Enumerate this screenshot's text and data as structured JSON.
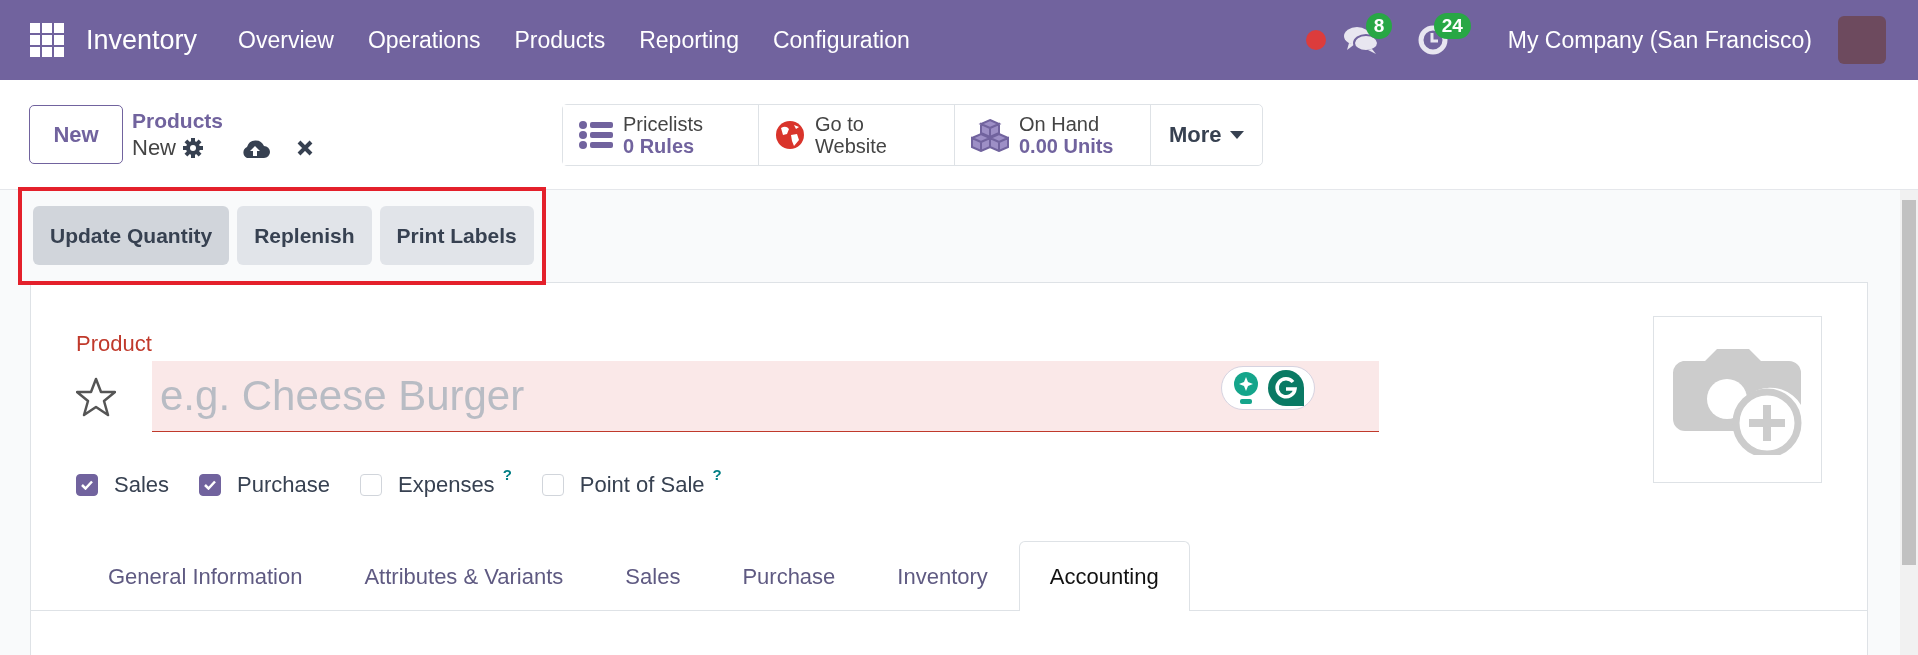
{
  "navbar": {
    "app_name": "Inventory",
    "menu": [
      "Overview",
      "Operations",
      "Products",
      "Reporting",
      "Configuration"
    ],
    "messages_badge": "8",
    "activities_badge": "24",
    "company": "My Company (San Francisco)"
  },
  "control_panel": {
    "new_button": "New",
    "breadcrumb": {
      "parent": "Products",
      "current": "New"
    },
    "stat_buttons": [
      {
        "kind": "stat",
        "label": "Pricelists",
        "value": "0 Rules"
      },
      {
        "kind": "link",
        "label": "Go to Website"
      },
      {
        "kind": "stat",
        "label": "On Hand",
        "value": "0.00 Units"
      }
    ],
    "more_button": "More"
  },
  "action_bar": {
    "highlighted": true,
    "buttons": [
      {
        "label": "Update Quantity",
        "active": true
      },
      {
        "label": "Replenish",
        "active": false
      },
      {
        "label": "Print Labels",
        "active": false
      }
    ]
  },
  "form": {
    "name_label": "Product",
    "favorite": false,
    "name_placeholder": "e.g. Cheese Burger",
    "name_invalid": true,
    "options": [
      {
        "label": "Sales",
        "checked": true
      },
      {
        "label": "Purchase",
        "checked": true
      },
      {
        "label": "Expenses",
        "checked": false,
        "help": "?"
      },
      {
        "label": "Point of Sale",
        "checked": false,
        "help": "?"
      }
    ]
  },
  "tabs": [
    {
      "label": "General Information",
      "selected": false
    },
    {
      "label": "Attributes & Variants",
      "selected": false
    },
    {
      "label": "Sales",
      "selected": false
    },
    {
      "label": "Purchase",
      "selected": false
    },
    {
      "label": "Inventory",
      "selected": false
    },
    {
      "label": "Accounting",
      "selected": true
    }
  ]
}
